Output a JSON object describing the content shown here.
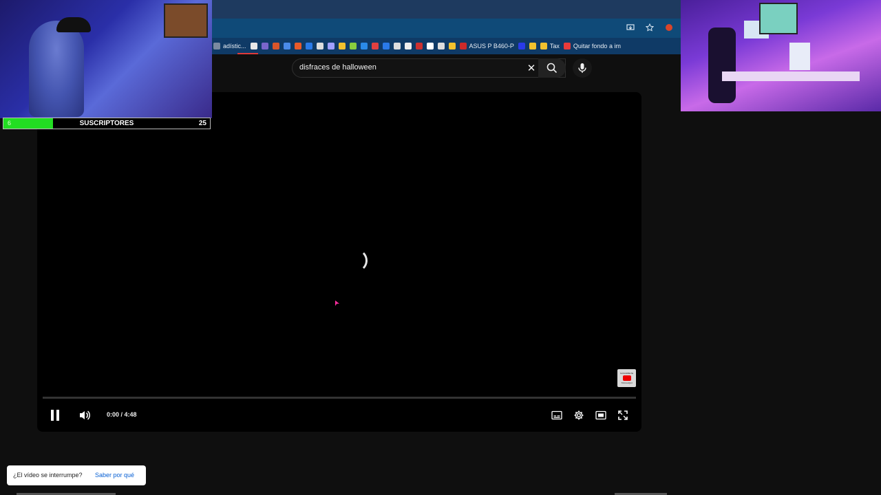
{
  "browser": {
    "bookmarks": [
      {
        "label": "adístic...",
        "color": "#7a8aa0"
      },
      {
        "label": "",
        "color": "#e8e8e8",
        "icon": "google-icon"
      },
      {
        "label": "",
        "color": "#7a66cc",
        "icon": "globe-icon"
      },
      {
        "label": "",
        "color": "#d9552a",
        "icon": "chart-icon"
      },
      {
        "label": "",
        "color": "#4a8ae8",
        "icon": "docs-icon"
      },
      {
        "label": "",
        "color": "#e85a2a",
        "icon": "app-icon"
      },
      {
        "label": "",
        "color": "#2a7ae8",
        "icon": "puzzle-icon"
      },
      {
        "label": "",
        "color": "#dddddd",
        "icon": "info-icon"
      },
      {
        "label": "",
        "color": "#a0a0ff",
        "icon": "wave-icon"
      },
      {
        "label": "",
        "color": "#f2c12e",
        "icon": "coin-icon"
      },
      {
        "label": "",
        "color": "#8acd3e",
        "icon": "leaf-icon"
      },
      {
        "label": "",
        "color": "#2a8ae8",
        "icon": "k-icon"
      },
      {
        "label": "",
        "color": "#e04040",
        "icon": "pin-icon"
      },
      {
        "label": "",
        "color": "#2a7ae8",
        "icon": "puzzle-icon"
      },
      {
        "label": "",
        "color": "#dddddd",
        "icon": "circle-icon"
      },
      {
        "label": "",
        "color": "#eeeeee",
        "icon": "github-icon"
      },
      {
        "label": "",
        "color": "#cc3030",
        "icon": "app-icon"
      },
      {
        "label": "",
        "color": "#ffffff",
        "icon": "d-icon"
      },
      {
        "label": "",
        "color": "#dddddd",
        "icon": "grid-icon"
      },
      {
        "label": "",
        "color": "#f2c12e",
        "icon": "battery-icon"
      },
      {
        "label": "ASUS P B460-P",
        "color": "#cc2a2a",
        "icon": "asus-icon"
      },
      {
        "label": "",
        "color": "#2a3ae8",
        "icon": "star-icon"
      },
      {
        "label": "",
        "color": "#f2c12e",
        "icon": "binance-icon"
      },
      {
        "label": "Tax",
        "color": "#f2c12e",
        "icon": "binance-icon"
      },
      {
        "label": "Quitar fondo a im",
        "color": "#e83a3a",
        "icon": "x-icon"
      }
    ]
  },
  "search": {
    "query": "disfraces de halloween",
    "clear_symbol": "✕"
  },
  "player": {
    "time": "0:00 / 4:48",
    "subscribe_badge": {
      "line1": "SUSCRIBETE",
      "line2": "TOCA AQUI"
    }
  },
  "overlay": {
    "subscribers_label": "SUSCRIPTORES",
    "subscribers_current": "6",
    "subscribers_goal": "25",
    "progress": 0.24
  },
  "notice": {
    "question": "¿El vídeo se interrumpe?",
    "link": "Saber por qué"
  }
}
